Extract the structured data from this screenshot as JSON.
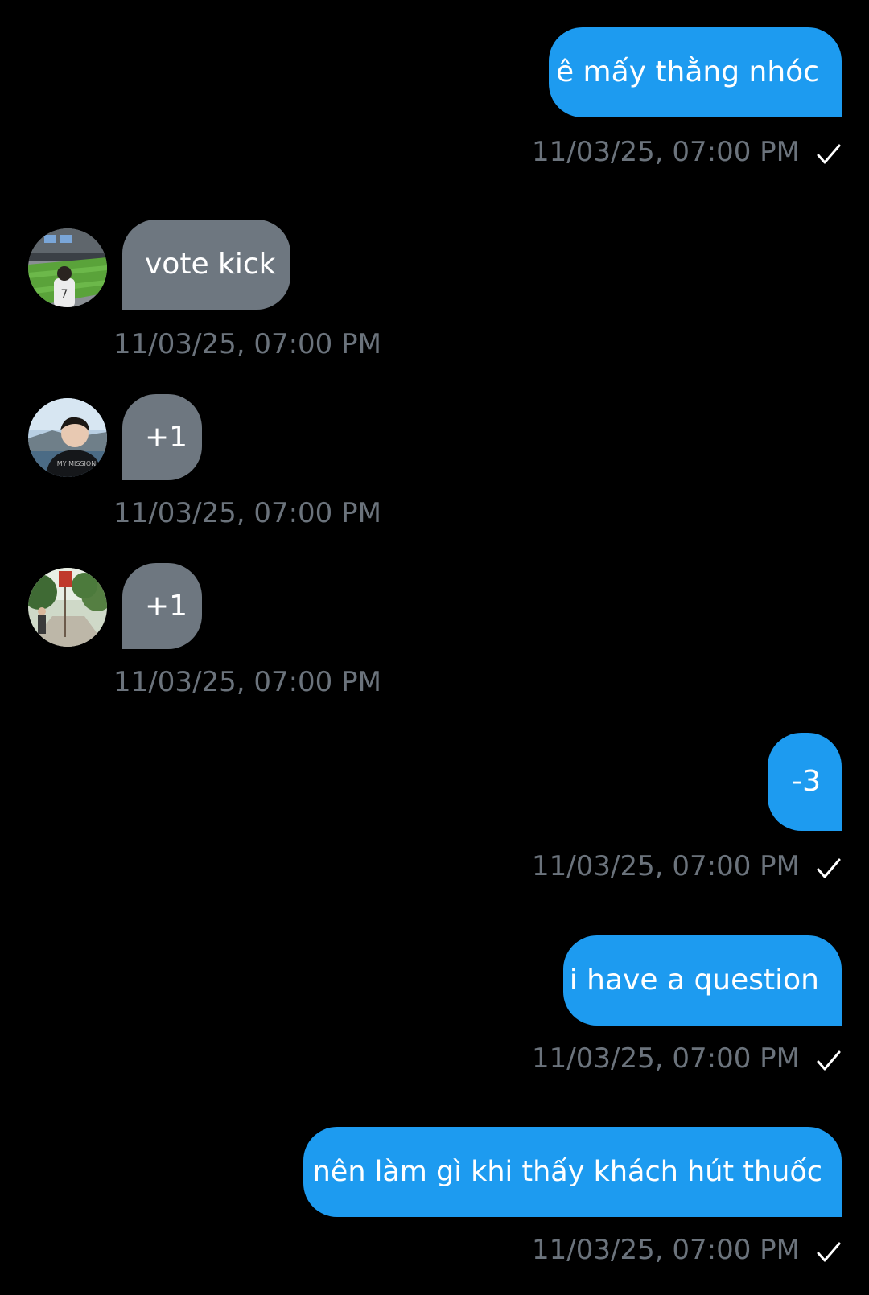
{
  "colors": {
    "background": "#000000",
    "outgoing_bubble": "#1d9bf0",
    "incoming_bubble": "#6e7780",
    "timestamp": "#6b737c",
    "text": "#ffffff"
  },
  "messages": [
    {
      "direction": "outgoing",
      "text": "ê mấy thằng nhóc",
      "timestamp": "11/03/25, 07:00 PM",
      "status_icon": "check-icon"
    },
    {
      "direction": "incoming",
      "text": "vote kick",
      "timestamp": "11/03/25, 07:00 PM",
      "avatar_icon": "stadium-photo-avatar"
    },
    {
      "direction": "incoming",
      "text": "+1",
      "timestamp": "11/03/25, 07:00 PM",
      "avatar_icon": "person-photo-avatar"
    },
    {
      "direction": "incoming",
      "text": "+1",
      "timestamp": "11/03/25, 07:00 PM",
      "avatar_icon": "street-photo-avatar"
    },
    {
      "direction": "outgoing",
      "text": "-3",
      "timestamp": "11/03/25, 07:00 PM",
      "status_icon": "check-icon"
    },
    {
      "direction": "outgoing",
      "text": "i have a question",
      "timestamp": "11/03/25, 07:00 PM",
      "status_icon": "check-icon"
    },
    {
      "direction": "outgoing",
      "text": "nên làm gì khi thấy khách hút thuốc",
      "timestamp": "11/03/25, 07:00 PM",
      "status_icon": "check-icon"
    }
  ]
}
